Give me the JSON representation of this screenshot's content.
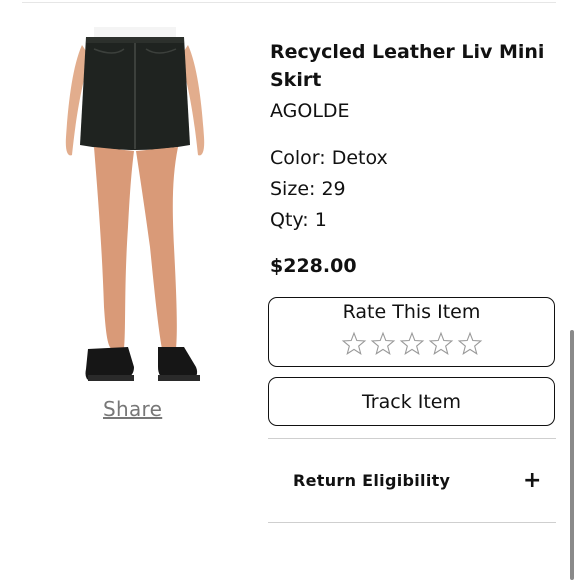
{
  "product": {
    "title": "Recycled Leather Liv Mini Skirt",
    "brand": "AGOLDE",
    "color": "Color: Detox",
    "size": "Size: 29",
    "qty": "Qty: 1",
    "price": "$228.00",
    "image_icon": "product-photo"
  },
  "actions": {
    "share_label": "Share",
    "rate_label": "Rate This Item",
    "rating_stars": 0,
    "rating_max": 5,
    "track_label": "Track Item"
  },
  "accordion": {
    "return_label": "Return Eligibility",
    "expand_symbol": "+"
  }
}
